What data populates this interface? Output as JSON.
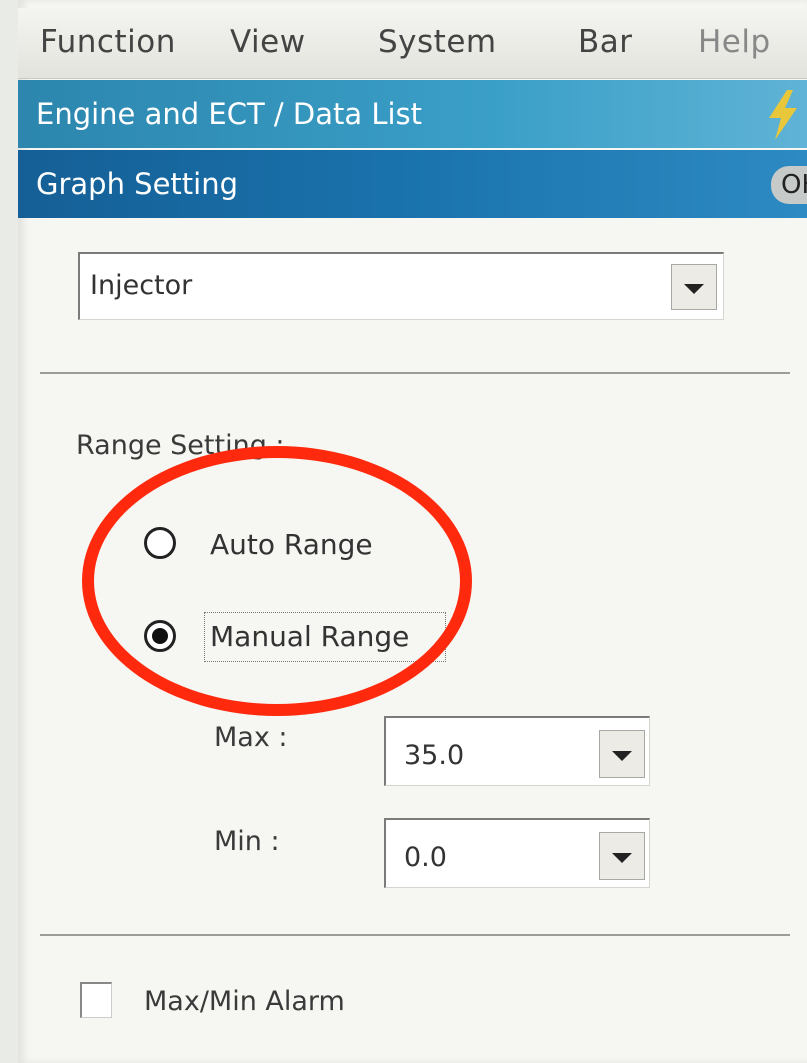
{
  "menu": {
    "items": [
      {
        "label": "Function"
      },
      {
        "label": "View"
      },
      {
        "label": "System"
      },
      {
        "label": "Bar"
      },
      {
        "label": "Help"
      }
    ]
  },
  "header": {
    "title": "Engine and ECT / Data List",
    "icon": "lightning-icon"
  },
  "subheader": {
    "title": "Graph Setting",
    "ok_label": "OK"
  },
  "item_select": {
    "value": "Injector"
  },
  "range": {
    "label": "Range Setting :",
    "auto_label": "Auto Range",
    "manual_label": "Manual Range",
    "selected": "Manual Range",
    "max_label": "Max :",
    "max_value": "35.0",
    "min_label": "Min :",
    "min_value": "0.0"
  },
  "alarm": {
    "label": "Max/Min Alarm",
    "checked": false
  },
  "colors": {
    "annotation": "#ff2a0e",
    "header": "#2c86ae",
    "subheader": "#155f96"
  }
}
